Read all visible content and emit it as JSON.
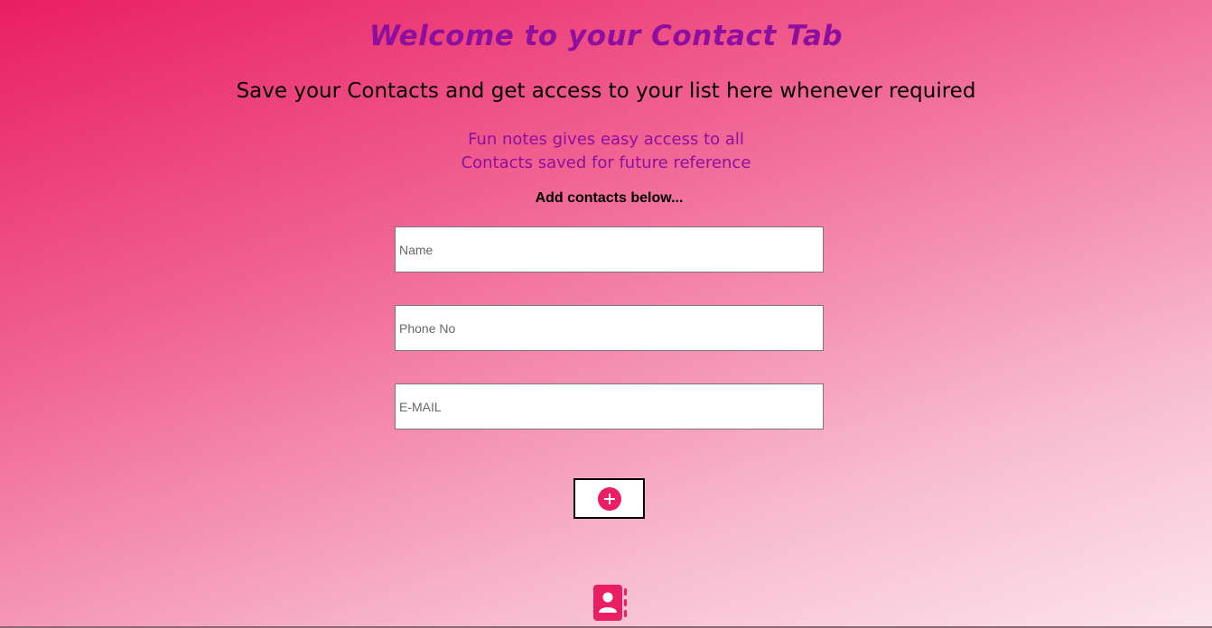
{
  "header": {
    "title": "Welcome to your Contact Tab",
    "subtitle": "Save your Contacts and get access to your list here whenever required",
    "tagline_line1": "Fun notes gives easy access to all",
    "tagline_line2": "Contacts saved for future reference"
  },
  "form": {
    "label": "Add contacts below...",
    "name_placeholder": "Name",
    "phone_placeholder": "Phone No",
    "email_placeholder": "E-MAIL",
    "name_value": "",
    "phone_value": "",
    "email_value": "",
    "add_button_icon": "plus-circle-icon"
  },
  "footer": {
    "icon": "address-book-icon"
  },
  "colors": {
    "accent": "#e91e63",
    "title": "#8e0e9e",
    "gradient_start": "#e91e63",
    "gradient_end": "#fce4ec"
  }
}
